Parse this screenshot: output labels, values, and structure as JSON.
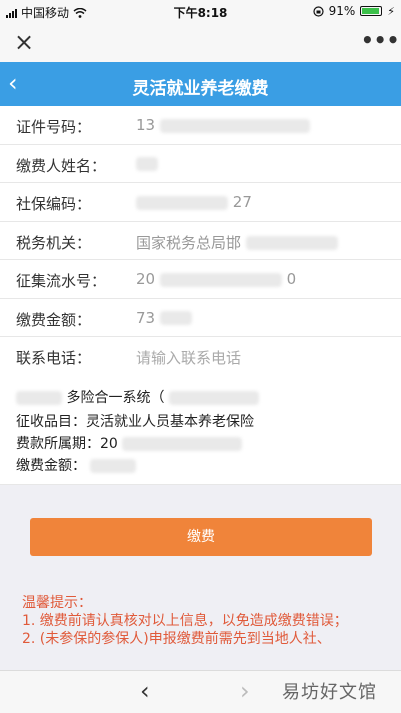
{
  "status_bar": {
    "carrier": "中国移动",
    "time": "下午8:18",
    "battery_percent": "91%",
    "battery_level": 0.91,
    "icons": [
      "signal-icon",
      "wifi-icon",
      "lock-rotation-icon",
      "battery-icon",
      "charging-icon"
    ]
  },
  "wx_bar": {
    "close_icon": "×",
    "more_icon": "•••"
  },
  "header": {
    "back_icon": "‹",
    "title": "灵活就业养老缴费"
  },
  "form": {
    "rows": [
      {
        "label": "证件号码：",
        "value": "13"
      },
      {
        "label": "缴费人姓名：",
        "value": ""
      },
      {
        "label": "社保编码：",
        "value": "27"
      },
      {
        "label": "税务机关：",
        "value": "国家税务总局邯"
      },
      {
        "label": "征集流水号：",
        "value_start": "20",
        "value_end": "0"
      },
      {
        "label": "缴费金额：",
        "value": "73"
      },
      {
        "label": "联系电话：",
        "placeholder": "请输入联系电话"
      }
    ]
  },
  "info": {
    "line1": "多险合一系统（",
    "line2": "征收品目：灵活就业人员基本养老保险",
    "line3": "费款所属期：20",
    "line4": "缴费金额："
  },
  "pay_button": {
    "label": "缴费"
  },
  "tips": {
    "title": "温馨提示：",
    "item1": "1. 缴费前请认真核对以上信息，以免造成缴费错误；",
    "item2": "2. (未参保的参保人)申报缴费前需先到当地人社、"
  },
  "bottom_nav": {
    "back_icon": "‹",
    "forward_icon": "›"
  },
  "watermark": "易坊好文馆"
}
